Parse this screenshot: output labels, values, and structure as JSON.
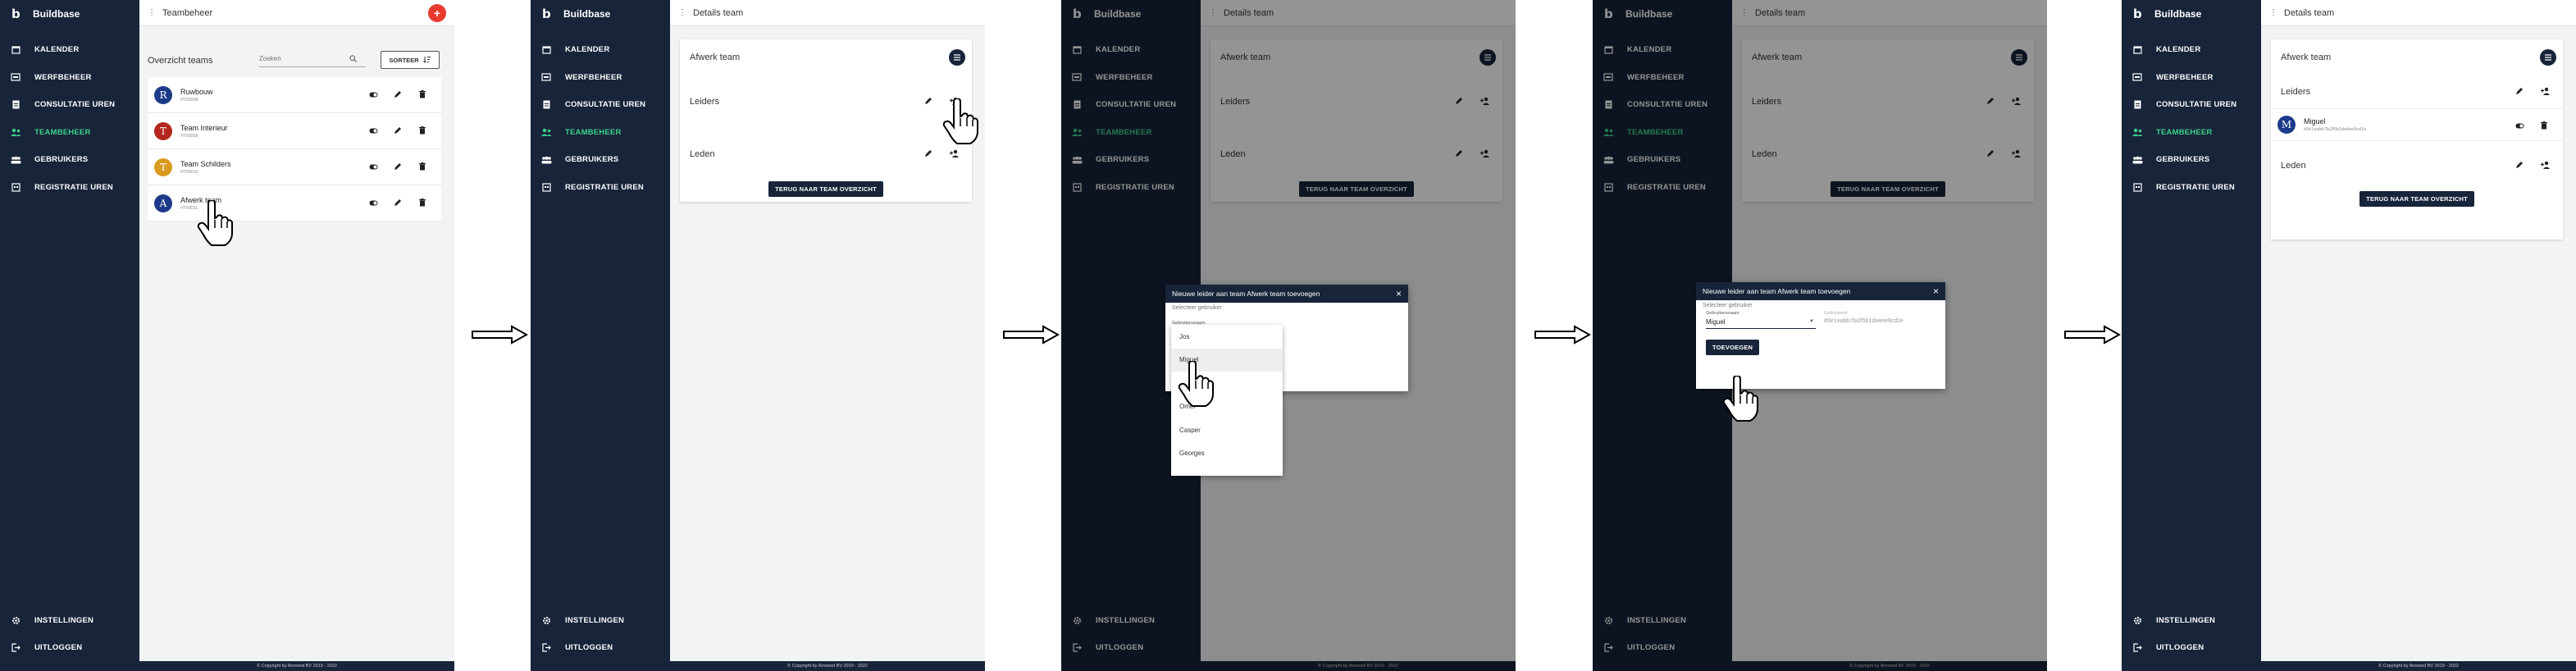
{
  "brand": {
    "letter": "b",
    "name": "Buildbase"
  },
  "nav": {
    "items": [
      {
        "label": "KALENDER",
        "icon": "calendar-icon"
      },
      {
        "label": "WERFBEHEER",
        "icon": "worksite-icon"
      },
      {
        "label": "CONSULTATIE UREN",
        "icon": "document-icon"
      },
      {
        "label": "TEAMBEHEER",
        "icon": "team-icon"
      },
      {
        "label": "GEBRUIKERS",
        "icon": "users-icon"
      },
      {
        "label": "REGISTRATIE UREN",
        "icon": "registration-icon"
      }
    ],
    "bottom": [
      {
        "label": "INSTELLINGEN",
        "icon": "gear-icon"
      },
      {
        "label": "UITLOGGEN",
        "icon": "logout-icon"
      }
    ],
    "active_color": "#3fd18b"
  },
  "footer": {
    "text": "© Copyright by Arrowed BV 2019 - 2022"
  },
  "screen1": {
    "title": "Teambeheer",
    "overview_title": "Overzicht teams",
    "search_placeholder": "Zoeken",
    "sort_label": "SORTEER",
    "teams": [
      {
        "name": "Ruwbouw",
        "id": "#T00008",
        "initial": "R",
        "color": "#1d3a8a"
      },
      {
        "name": "Team Interieur",
        "id": "#T00009",
        "initial": "T",
        "color": "#b3261e"
      },
      {
        "name": "Team Schilders",
        "id": "#T00010",
        "initial": "T",
        "color": "#d99a1e"
      },
      {
        "name": "Afwerk team",
        "id": "#T00011",
        "initial": "A",
        "color": "#1d3a8a"
      }
    ]
  },
  "details": {
    "title": "Details team",
    "team_name": "Afwerk team",
    "leaders_label": "Leiders",
    "members_label": "Leden",
    "back_label": "TERUG NAAR TEAM OVERZICHT"
  },
  "dialog": {
    "title": "Nieuwe leider aan team Afwerk team toevoegen",
    "subtitle": "Selecteer gebruiker",
    "username_label": "Gebruikersnaam",
    "options": [
      "Jos",
      "Miguel",
      "Omer",
      "Casper",
      "Georges"
    ],
    "selected": "Miguel",
    "userid_label": "Gebruikerid",
    "userid_value": "#0e1eabb7fa2f5b1da4ee9cd1e",
    "add_label": "TOEVOEGEN",
    "close": "×"
  },
  "result": {
    "leader_name": "Miguel",
    "leader_initial": "M",
    "leader_id": "#0e1eabb7fa2f5b1da4ee9cd1e"
  }
}
